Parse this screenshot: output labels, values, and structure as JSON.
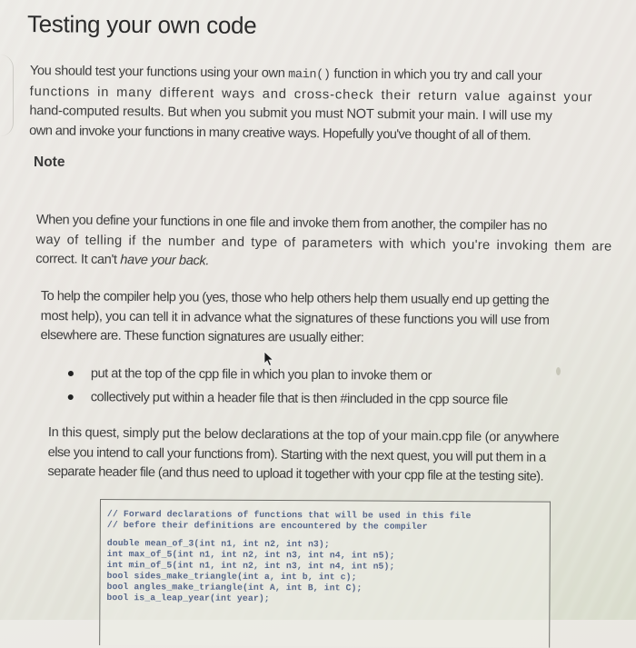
{
  "page": {
    "title": "Testing your own code",
    "intro": {
      "lines": [
        {
          "before": "You should test your functions using your own ",
          "code": "main()",
          "after": " function in which you try and call your"
        },
        {
          "text": "functions in many different ways and cross-check their return value against your"
        },
        {
          "text": "hand-computed results. But when you submit you must NOT submit your main. I will use my"
        },
        {
          "text": "own and invoke your functions in many creative ways. Hopefully you've thought of all of them."
        }
      ]
    },
    "note": {
      "heading": "Note",
      "paragraph1": {
        "lines": [
          "When you define your functions in one file and invoke them from another, the compiler has no",
          "way of telling if the number and type of parameters with which you're invoking them are"
        ],
        "last_line_prefix": "correct. It can't ",
        "last_line_emphasis": "have your back."
      },
      "paragraph2": {
        "lines": [
          "To help the compiler help you (yes, those who help others help them usually end up getting the",
          "most help), you can tell it in advance what the signatures of these functions you will use from",
          "elsewhere are. These function signatures are usually either:"
        ]
      },
      "bullets": [
        "put at the top of the cpp file in which you plan to invoke them or",
        "collectively put within a header file that is then #included in the cpp source file"
      ],
      "paragraph3": {
        "lines": [
          "In this quest, simply put the below declarations at the top of your main.cpp file (or anywhere",
          "else you intend to call your functions from). Starting with the next quest, you will put them in a",
          "separate header file (and thus need to upload it together with your cpp file at the testing site)."
        ]
      }
    },
    "code_block": {
      "comments": [
        "// Forward declarations of functions that will be used in this file",
        "// before their definitions are encountered by the compiler"
      ],
      "declarations": [
        "double mean_of_3(int n1, int n2, int n3);",
        "int max_of_5(int n1, int n2, int n3, int n4, int n5);",
        "int min_of_5(int n1, int n2, int n3, int n4, int n5);",
        "bool sides_make_triangle(int a, int b, int c);",
        "bool angles_make_triangle(int A, int B, int C);",
        "bool is_a_leap_year(int year);"
      ]
    },
    "icons": {
      "cursor": "mouse-pointer-icon",
      "bullet": "bullet-dot-icon"
    }
  }
}
